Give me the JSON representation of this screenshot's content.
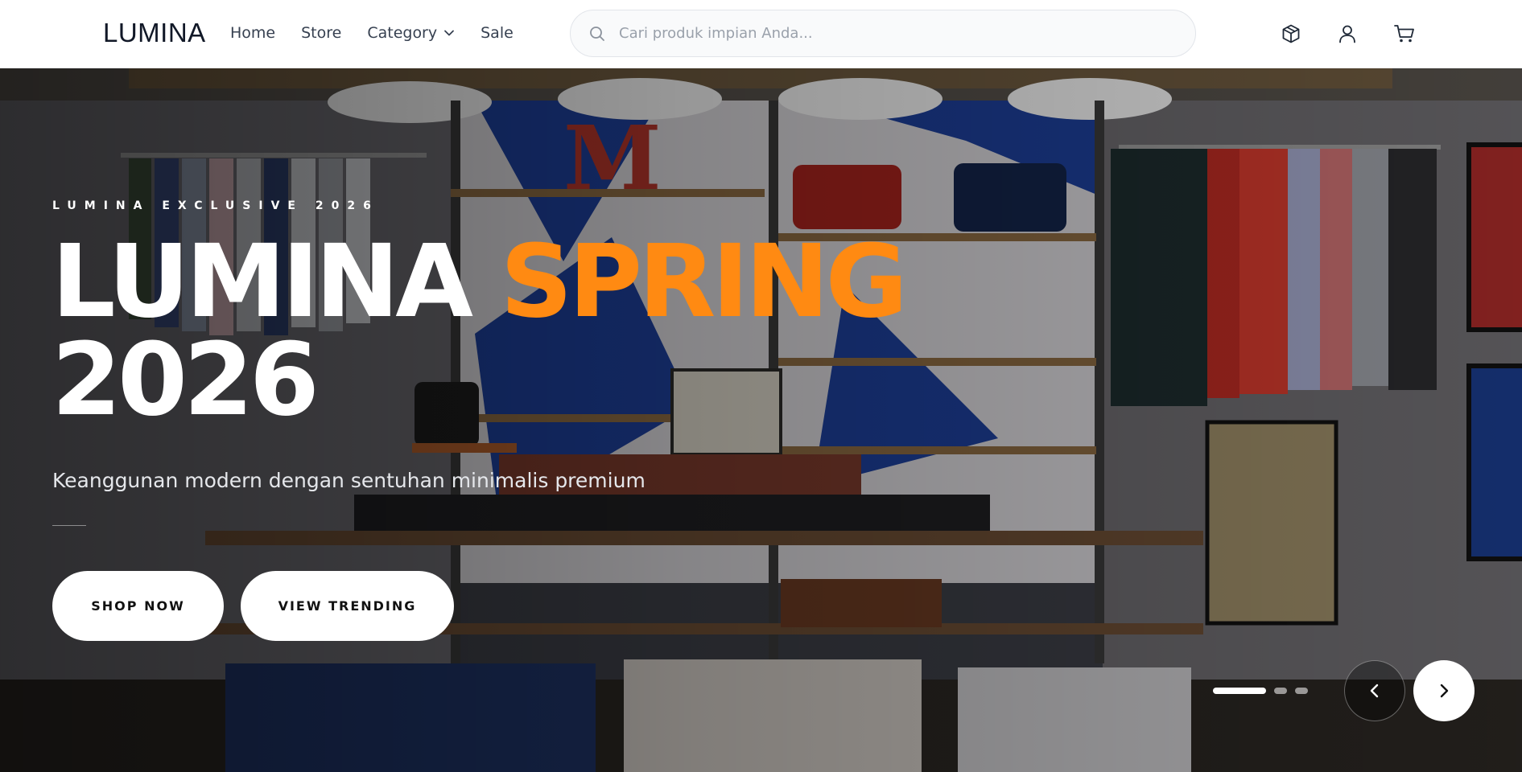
{
  "brand": {
    "logo": "LUMINA"
  },
  "nav": {
    "home": "Home",
    "store": "Store",
    "category": "Category",
    "sale": "Sale"
  },
  "search": {
    "placeholder": "Cari produk impian Anda...",
    "value": ""
  },
  "header_icons": [
    "box-icon",
    "user-icon",
    "cart-icon"
  ],
  "hero": {
    "eyebrow": "LUMINA EXCLUSIVE 2026",
    "headline_part1": "LUMINA",
    "headline_accent": "SPRING",
    "headline_part2": "2026",
    "subtitle": "Keanggunan modern dengan sentuhan minimalis premium",
    "cta_primary": "SHOP NOW",
    "cta_secondary": "VIEW TRENDING",
    "slides_total": 3,
    "active_slide": 1,
    "background_description_icon": "store-interior-photo"
  },
  "colors": {
    "accent": "#ff8a12",
    "nav_text": "#374151",
    "logo": "#111827",
    "button_bg": "#ffffff"
  }
}
